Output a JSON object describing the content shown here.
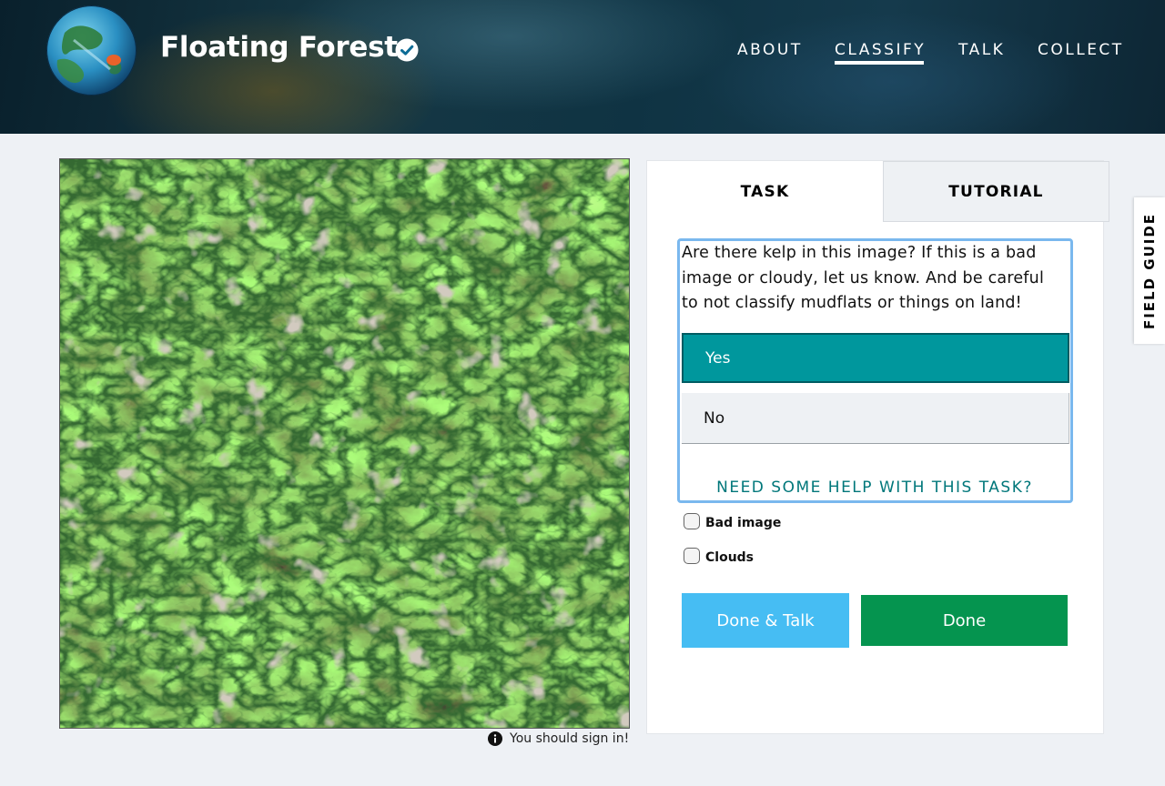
{
  "header": {
    "site_title": "Floating Forests",
    "verified_icon": "check-circle-icon",
    "logo_icon": "earth-globe-logo",
    "nav": {
      "about": "ABOUT",
      "classify": "CLASSIFY",
      "talk": "TALK",
      "collect": "COLLECT",
      "active": "classify"
    }
  },
  "subject": {
    "image_icon": "satellite-image",
    "signin_icon": "info-circle-icon",
    "signin_text": "You should sign in!"
  },
  "panel": {
    "tabs": {
      "task": "TASK",
      "tutorial": "TUTORIAL",
      "active": "task"
    },
    "question": "Are there kelp in this image? If this is a bad image or cloudy, let us know. And be careful to not classify mudflats or things on land!",
    "answers": {
      "yes": "Yes",
      "no": "No",
      "selected": "yes"
    },
    "help_link": "NEED SOME HELP WITH THIS TASK?",
    "checkboxes": {
      "bad_image": "Bad image",
      "clouds": "Clouds"
    },
    "buttons": {
      "done_talk": "Done & Talk",
      "done": "Done"
    }
  },
  "field_guide": {
    "label": "FIELD GUIDE"
  },
  "colors": {
    "selected_answer": "#00979d",
    "done_button": "#05944f",
    "done_talk_button": "#46bdf3",
    "task_outline": "#7ab8ee",
    "help_link": "#00777a"
  }
}
